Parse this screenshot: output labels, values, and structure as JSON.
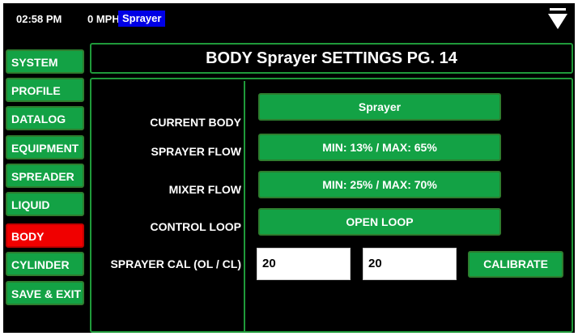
{
  "status_bar": {
    "time": "02:58 PM",
    "speed": "0 MPH",
    "mode": "Sprayer",
    "menu_icon": "down-triangle-icon"
  },
  "sidebar": {
    "items": [
      {
        "label": "SYSTEM",
        "active": false
      },
      {
        "label": "PROFILE",
        "active": false
      },
      {
        "label": "DATALOG",
        "active": false
      },
      {
        "label": "EQUIPMENT",
        "active": false
      },
      {
        "label": "SPREADER",
        "active": false
      },
      {
        "label": "LIQUID",
        "active": false
      },
      {
        "label": "BODY",
        "active": true
      },
      {
        "label": "CYLINDER",
        "active": false
      },
      {
        "label": "SAVE & EXIT",
        "active": false
      }
    ]
  },
  "page": {
    "title": "BODY Sprayer SETTINGS PG. 14"
  },
  "settings": {
    "current_body": {
      "label": "CURRENT BODY",
      "value": "Sprayer"
    },
    "sprayer_flow": {
      "label": "SPRAYER FLOW",
      "value": "MIN: 13% / MAX: 65%"
    },
    "mixer_flow": {
      "label": "MIXER FLOW",
      "value": "MIN: 25% / MAX: 70%"
    },
    "control_loop": {
      "label": "CONTROL LOOP",
      "value": "OPEN LOOP"
    },
    "sprayer_cal": {
      "label": "SPRAYER CAL (OL / CL)",
      "open_loop_value": "20",
      "closed_loop_value": "20",
      "calibrate_label": "CALIBRATE"
    }
  },
  "colors": {
    "background": "#000000",
    "button_green": "#13a245",
    "border_green": "#1f9a3a",
    "active_red": "#f00000",
    "mode_blue": "#0000e6",
    "text": "#ffffff"
  }
}
